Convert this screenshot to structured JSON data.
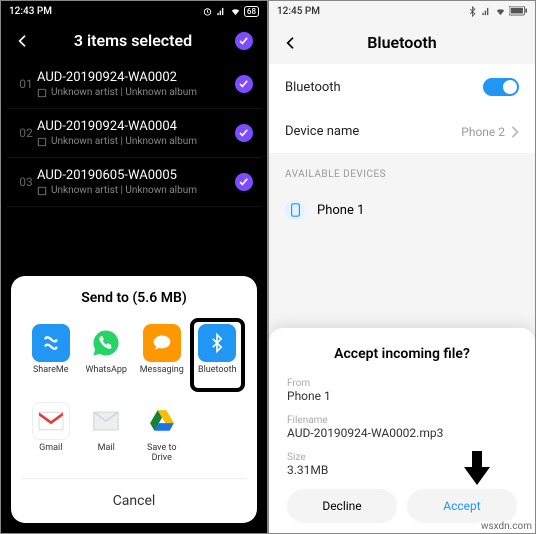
{
  "left": {
    "statusbar": {
      "time": "12:43 PM",
      "battery": "68"
    },
    "header": {
      "title": "3 items selected"
    },
    "tracks": [
      {
        "num": "01",
        "title": "AUD-20190924-WA0002",
        "sub": "Unknown artist | Unknown album"
      },
      {
        "num": "02",
        "title": "AUD-20190924-WA0004",
        "sub": "Unknown artist | Unknown album"
      },
      {
        "num": "03",
        "title": "AUD-20190605-WA0005",
        "sub": "Unknown artist | Unknown album"
      }
    ],
    "share": {
      "title": "Send to (5.6 MB)",
      "items": [
        {
          "label": "ShareMe",
          "icon": "shareme"
        },
        {
          "label": "WhatsApp",
          "icon": "whatsapp"
        },
        {
          "label": "Messaging",
          "icon": "messaging"
        },
        {
          "label": "Bluetooth",
          "icon": "bluetooth",
          "highlight": true
        },
        {
          "label": "Gmail",
          "icon": "gmail"
        },
        {
          "label": "Mail",
          "icon": "mail"
        },
        {
          "label": "Save to\nDrive",
          "icon": "drive"
        }
      ],
      "cancel": "Cancel"
    }
  },
  "right": {
    "statusbar": {
      "time": "12:45 PM"
    },
    "header": {
      "title": "Bluetooth"
    },
    "settings": {
      "bluetooth_label": "Bluetooth",
      "devicename_label": "Device name",
      "devicename_value": "Phone 2",
      "section": "AVAILABLE DEVICES",
      "device0": "Phone 1"
    },
    "incoming": {
      "title": "Accept incoming file?",
      "from_label": "From",
      "from_value": "Phone 1",
      "file_label": "Filename",
      "file_value": "AUD-20190924-WA0002.mp3",
      "size_label": "Size",
      "size_value": "3.31MB",
      "decline": "Decline",
      "accept": "Accept"
    }
  },
  "watermark": "wsxdn.com"
}
